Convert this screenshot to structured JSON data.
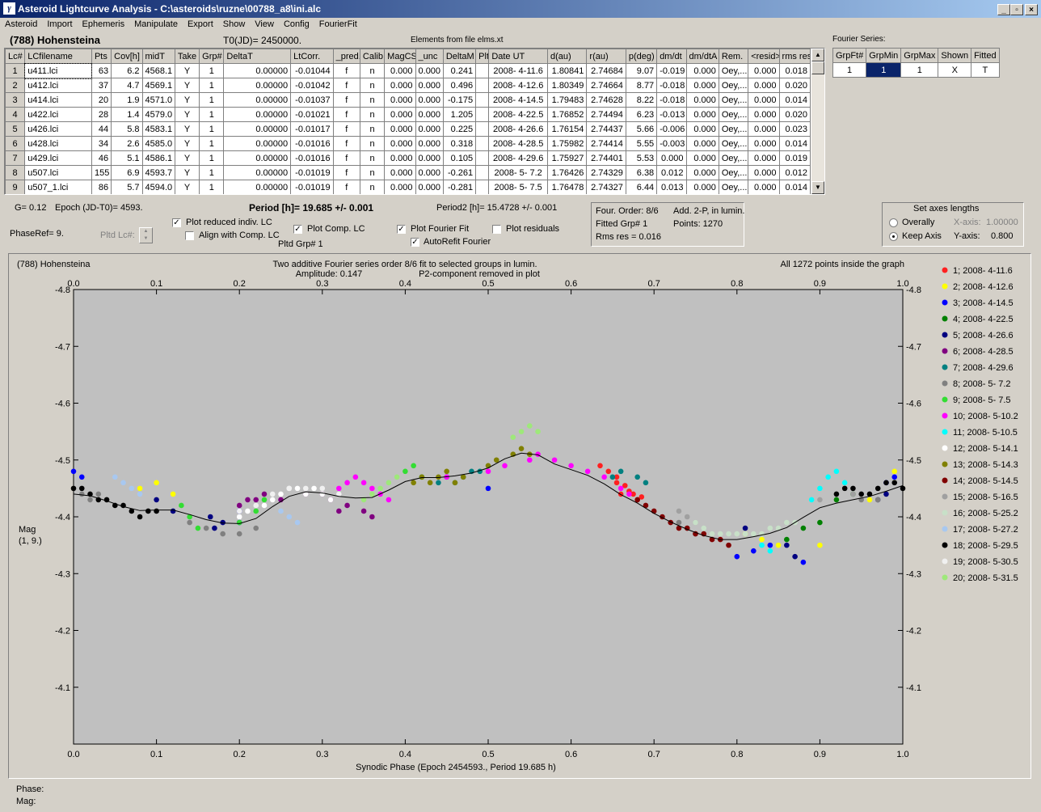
{
  "window": {
    "title": "Asteroid Lightcurve Analysis - C:\\asteroids\\ruzne\\00788_a8\\ini.alc",
    "min_label": "_",
    "max_label": "▫",
    "close_label": "×"
  },
  "menu": [
    "Asteroid",
    "Import",
    "Ephemeris",
    "Manipulate",
    "Export",
    "Show",
    "View",
    "Config",
    "FourierFit"
  ],
  "header": {
    "asteroid": "(788) Hohensteina",
    "t0": "T0(JD)= 2450000.",
    "elements": "Elements from file elms.xt"
  },
  "lc_table": {
    "columns": [
      "Lc#",
      "LCfilename",
      "Pts",
      "Cov[h]",
      "midT",
      "Take",
      "Grp#",
      "DeltaT",
      "LtCorr.",
      "_pred.",
      "Calib.",
      "MagCS",
      "_unc",
      "DeltaM",
      "Plt",
      "Date UT",
      "d(au)",
      "r(au)",
      "p(deg)",
      "dm/dt",
      "dm/dtA",
      "Rem.",
      "<resid>",
      "rms res"
    ],
    "rows": [
      [
        "1",
        "u411.lci",
        "63",
        "6.2",
        "4568.1",
        "Y",
        "1",
        "0.00000",
        "-0.01044",
        "f",
        "n",
        "0.000",
        "0.000",
        "0.241",
        "",
        "2008- 4-11.6",
        "1.80841",
        "2.74684",
        "9.07",
        "-0.019",
        "0.000",
        "Oey,...",
        "0.000",
        "0.018"
      ],
      [
        "2",
        "u412.lci",
        "37",
        "4.7",
        "4569.1",
        "Y",
        "1",
        "0.00000",
        "-0.01042",
        "f",
        "n",
        "0.000",
        "0.000",
        "0.496",
        "",
        "2008- 4-12.6",
        "1.80349",
        "2.74664",
        "8.77",
        "-0.018",
        "0.000",
        "Oey,...",
        "0.000",
        "0.020"
      ],
      [
        "3",
        "u414.lci",
        "20",
        "1.9",
        "4571.0",
        "Y",
        "1",
        "0.00000",
        "-0.01037",
        "f",
        "n",
        "0.000",
        "0.000",
        "-0.175",
        "",
        "2008- 4-14.5",
        "1.79483",
        "2.74628",
        "8.22",
        "-0.018",
        "0.000",
        "Oey,...",
        "0.000",
        "0.014"
      ],
      [
        "4",
        "u422.lci",
        "28",
        "1.4",
        "4579.0",
        "Y",
        "1",
        "0.00000",
        "-0.01021",
        "f",
        "n",
        "0.000",
        "0.000",
        "1.205",
        "",
        "2008- 4-22.5",
        "1.76852",
        "2.74494",
        "6.23",
        "-0.013",
        "0.000",
        "Oey,...",
        "0.000",
        "0.020"
      ],
      [
        "5",
        "u426.lci",
        "44",
        "5.8",
        "4583.1",
        "Y",
        "1",
        "0.00000",
        "-0.01017",
        "f",
        "n",
        "0.000",
        "0.000",
        "0.225",
        "",
        "2008- 4-26.6",
        "1.76154",
        "2.74437",
        "5.66",
        "-0.006",
        "0.000",
        "Oey,...",
        "0.000",
        "0.023"
      ],
      [
        "6",
        "u428.lci",
        "34",
        "2.6",
        "4585.0",
        "Y",
        "1",
        "0.00000",
        "-0.01016",
        "f",
        "n",
        "0.000",
        "0.000",
        "0.318",
        "",
        "2008- 4-28.5",
        "1.75982",
        "2.74414",
        "5.55",
        "-0.003",
        "0.000",
        "Oey,...",
        "0.000",
        "0.014"
      ],
      [
        "7",
        "u429.lci",
        "46",
        "5.1",
        "4586.1",
        "Y",
        "1",
        "0.00000",
        "-0.01016",
        "f",
        "n",
        "0.000",
        "0.000",
        "0.105",
        "",
        "2008- 4-29.6",
        "1.75927",
        "2.74401",
        "5.53",
        "0.000",
        "0.000",
        "Oey,...",
        "0.000",
        "0.019"
      ],
      [
        "8",
        "u507.lci",
        "155",
        "6.9",
        "4593.7",
        "Y",
        "1",
        "0.00000",
        "-0.01019",
        "f",
        "n",
        "0.000",
        "0.000",
        "-0.261",
        "",
        "2008- 5- 7.2",
        "1.76426",
        "2.74329",
        "6.38",
        "0.012",
        "0.000",
        "Oey,...",
        "0.000",
        "0.012"
      ],
      [
        "9",
        "u507_1.lci",
        "86",
        "5.7",
        "4594.0",
        "Y",
        "1",
        "0.00000",
        "-0.01019",
        "f",
        "n",
        "0.000",
        "0.000",
        "-0.281",
        "",
        "2008- 5- 7.5",
        "1.76478",
        "2.74327",
        "6.44",
        "0.013",
        "0.000",
        "Oey,...",
        "0.000",
        "0.014"
      ]
    ]
  },
  "fourier_series": {
    "label": "Fourier Series:",
    "columns": [
      "GrpFt#",
      "GrpMin",
      "GrpMax",
      "Shown",
      "Fitted"
    ],
    "row": [
      "1",
      "1",
      "1",
      "X",
      "T"
    ]
  },
  "params": {
    "g": "G= 0.12",
    "epoch": "Epoch (JD-T0)= 4593.",
    "phaseref": "PhaseRef= 9.",
    "period": "Period [h]= 19.685 +/- 0.001",
    "period2": "Period2 [h]= 15.4728 +/- 0.001",
    "pltd_lc": "Pltd Lc#:",
    "pltd_grp": "Pltd Grp#  1"
  },
  "checkboxes": [
    {
      "label": "Plot reduced indiv. LC",
      "checked": true
    },
    {
      "label": "Align with Comp. LC",
      "checked": false
    },
    {
      "label": "Plot Comp. LC",
      "checked": true
    },
    {
      "label": "Plot Fourier Fit",
      "checked": true
    },
    {
      "label": "AutoRefit Fourier",
      "checked": true
    },
    {
      "label": "Plot residuals",
      "checked": false
    }
  ],
  "fit_info": {
    "order": "Four. Order:  8/6",
    "add": "Add. 2-P, in lumin.",
    "fitted": "Fitted Grp# 1",
    "points": "Points: 1270",
    "rms": "Rms res     = 0.016"
  },
  "axes_box": {
    "title": "Set axes lengths",
    "overally": "Overally",
    "keep": "Keep Axis",
    "xaxis_label": "X-axis:",
    "xaxis_val": "1.00000",
    "yaxis_label": "Y-axis:",
    "yaxis_val": "0.800"
  },
  "status": {
    "phase": "Phase:",
    "mag": "Mag:"
  },
  "chart_data": {
    "type": "scatter",
    "title": "Two additive Fourier series order 8/6 fit to selected groups in lumin.",
    "subtitle_amp": "Amplitude: 0.147",
    "subtitle_p2": "P2-component removed in plot",
    "name_label": "(788) Hohensteina",
    "points_note": "All 1272 points inside the graph",
    "xlabel": "Synodic Phase (Epoch 2454593., Period 19.685 h)",
    "ylabel": "Mag",
    "ylabel2": "(1, 9.)",
    "xlim": [
      0,
      1
    ],
    "ylim": [
      -4.8,
      -4.0
    ],
    "xticks": [
      "0.0",
      "0.1",
      "0.2",
      "0.3",
      "0.4",
      "0.5",
      "0.6",
      "0.7",
      "0.8",
      "0.9",
      "1.0"
    ],
    "yticks": [
      "-4.8",
      "-4.7",
      "-4.6",
      "-4.5",
      "-4.4",
      "-4.3",
      "-4.2",
      "-4.1"
    ],
    "yticks_values": [
      -4.8,
      -4.7,
      -4.6,
      -4.5,
      -4.4,
      -4.3,
      -4.2,
      -4.1
    ],
    "grid": false,
    "fit_curve": {
      "x": [
        0.0,
        0.02,
        0.04,
        0.06,
        0.08,
        0.1,
        0.12,
        0.14,
        0.16,
        0.18,
        0.2,
        0.22,
        0.24,
        0.26,
        0.28,
        0.3,
        0.32,
        0.34,
        0.36,
        0.38,
        0.4,
        0.42,
        0.44,
        0.46,
        0.48,
        0.5,
        0.52,
        0.54,
        0.56,
        0.58,
        0.6,
        0.62,
        0.64,
        0.66,
        0.68,
        0.7,
        0.72,
        0.74,
        0.76,
        0.78,
        0.8,
        0.82,
        0.84,
        0.86,
        0.88,
        0.9,
        0.92,
        0.94,
        0.96,
        0.98,
        1.0
      ],
      "y": [
        -4.44,
        -4.437,
        -4.428,
        -4.418,
        -4.411,
        -4.412,
        -4.412,
        -4.404,
        -4.395,
        -4.389,
        -4.388,
        -4.397,
        -4.418,
        -4.436,
        -4.444,
        -4.442,
        -4.436,
        -4.433,
        -4.434,
        -4.447,
        -4.462,
        -4.469,
        -4.469,
        -4.472,
        -4.477,
        -4.486,
        -4.502,
        -4.512,
        -4.509,
        -4.493,
        -4.483,
        -4.473,
        -4.458,
        -4.439,
        -4.424,
        -4.406,
        -4.391,
        -4.378,
        -4.367,
        -4.36,
        -4.36,
        -4.365,
        -4.371,
        -4.381,
        -4.399,
        -4.416,
        -4.424,
        -4.43,
        -4.436,
        -4.445,
        -4.455
      ]
    },
    "series": [
      {
        "name": "1; 2008- 4-11.6",
        "color": "#ff2020",
        "x": [
          0.635,
          0.655,
          0.665,
          0.66,
          0.67,
          0.68,
          0.645,
          0.655,
          0.675,
          0.685
        ],
        "y": [
          -4.49,
          -4.47,
          -4.455,
          -4.44,
          -4.445,
          -4.43,
          -4.48,
          -4.46,
          -4.44,
          -4.435
        ]
      },
      {
        "name": "2; 2008- 4-12.6",
        "color": "#ffff00",
        "x": [
          0.1,
          0.12,
          0.81,
          0.83,
          0.85,
          0.9,
          0.99,
          0.08,
          0.96
        ],
        "y": [
          -4.46,
          -4.44,
          -4.37,
          -4.36,
          -4.35,
          -4.35,
          -4.48,
          -4.45,
          -4.43
        ]
      },
      {
        "name": "3; 2008- 4-14.5",
        "color": "#0000ff",
        "x": [
          0.0,
          0.01,
          0.2,
          0.2,
          0.5,
          0.8,
          0.82,
          0.84,
          0.88,
          0.99,
          0.98
        ],
        "y": [
          -4.48,
          -4.47,
          -4.41,
          -4.39,
          -4.45,
          -4.33,
          -4.34,
          -4.35,
          -4.32,
          -4.47,
          -4.46
        ]
      },
      {
        "name": "4; 2008- 4-22.5",
        "color": "#008000",
        "x": [
          0.86,
          0.88,
          0.9,
          0.92,
          0.94
        ],
        "y": [
          -4.36,
          -4.38,
          -4.39,
          -4.43,
          -4.44
        ]
      },
      {
        "name": "5; 2008- 4-26.6",
        "color": "#000080",
        "x": [
          0.1,
          0.12,
          0.165,
          0.17,
          0.18,
          0.81,
          0.86,
          0.87,
          0.97,
          0.98
        ],
        "y": [
          -4.43,
          -4.41,
          -4.4,
          -4.38,
          -4.39,
          -4.38,
          -4.35,
          -4.33,
          -4.43,
          -4.44
        ]
      },
      {
        "name": "6; 2008- 4-28.5",
        "color": "#800080",
        "x": [
          0.2,
          0.21,
          0.22,
          0.23,
          0.25,
          0.28,
          0.3,
          0.31,
          0.33,
          0.32,
          0.35,
          0.36
        ],
        "y": [
          -4.42,
          -4.43,
          -4.43,
          -4.44,
          -4.43,
          -4.44,
          -4.44,
          -4.43,
          -4.42,
          -4.41,
          -4.41,
          -4.4
        ]
      },
      {
        "name": "7; 2008- 4-29.6",
        "color": "#008080",
        "x": [
          0.42,
          0.44,
          0.45,
          0.46,
          0.47,
          0.48,
          0.49,
          0.65,
          0.66,
          0.68,
          0.69
        ],
        "y": [
          -4.47,
          -4.46,
          -4.47,
          -4.46,
          -4.47,
          -4.48,
          -4.48,
          -4.47,
          -4.48,
          -4.47,
          -4.46
        ]
      },
      {
        "name": "8; 2008- 5- 7.2",
        "color": "#808080",
        "x": [
          0.01,
          0.02,
          0.03,
          0.04,
          0.14,
          0.16,
          0.18,
          0.2,
          0.22,
          0.73,
          0.74,
          0.75,
          0.95,
          0.96,
          0.97
        ],
        "y": [
          -4.44,
          -4.43,
          -4.44,
          -4.43,
          -4.39,
          -4.38,
          -4.37,
          -4.37,
          -4.38,
          -4.39,
          -4.38,
          -4.37,
          -4.43,
          -4.44,
          -4.43
        ]
      },
      {
        "name": "9; 2008- 5- 7.5",
        "color": "#33dd33",
        "x": [
          0.13,
          0.14,
          0.15,
          0.2,
          0.22,
          0.23,
          0.4,
          0.41,
          0.42
        ],
        "y": [
          -4.42,
          -4.4,
          -4.38,
          -4.39,
          -4.41,
          -4.43,
          -4.48,
          -4.49,
          -4.47
        ]
      },
      {
        "name": "10; 2008- 5-10.2",
        "color": "#ff00ff",
        "x": [
          0.32,
          0.33,
          0.34,
          0.35,
          0.36,
          0.37,
          0.38,
          0.45,
          0.5,
          0.52,
          0.55,
          0.56,
          0.58,
          0.6,
          0.62,
          0.64,
          0.66,
          0.67
        ],
        "y": [
          -4.45,
          -4.46,
          -4.47,
          -4.46,
          -4.45,
          -4.44,
          -4.43,
          -4.47,
          -4.48,
          -4.49,
          -4.5,
          -4.51,
          -4.5,
          -4.49,
          -4.48,
          -4.47,
          -4.45,
          -4.44
        ]
      },
      {
        "name": "11; 2008- 5-10.5",
        "color": "#00ffff",
        "x": [
          0.83,
          0.84,
          0.89,
          0.9,
          0.91,
          0.92,
          0.93
        ],
        "y": [
          -4.35,
          -4.34,
          -4.43,
          -4.45,
          -4.47,
          -4.48,
          -4.46
        ]
      },
      {
        "name": "12; 2008- 5-14.1",
        "color": "#ffffff",
        "x": [
          0.2,
          0.21,
          0.23,
          0.24,
          0.25,
          0.26,
          0.27,
          0.28,
          0.29,
          0.3,
          0.31
        ],
        "y": [
          -4.4,
          -4.41,
          -4.42,
          -4.43,
          -4.44,
          -4.45,
          -4.45,
          -4.44,
          -4.45,
          -4.44,
          -4.43
        ]
      },
      {
        "name": "13; 2008- 5-14.3",
        "color": "#808000",
        "x": [
          0.41,
          0.42,
          0.43,
          0.44,
          0.45,
          0.46,
          0.47,
          0.5,
          0.51,
          0.53,
          0.54,
          0.55
        ],
        "y": [
          -4.46,
          -4.47,
          -4.46,
          -4.47,
          -4.48,
          -4.46,
          -4.47,
          -4.49,
          -4.5,
          -4.51,
          -4.52,
          -4.51
        ]
      },
      {
        "name": "14; 2008- 5-14.5",
        "color": "#800000",
        "x": [
          0.68,
          0.69,
          0.7,
          0.71,
          0.72,
          0.73,
          0.74,
          0.75,
          0.76,
          0.77,
          0.78,
          0.79
        ],
        "y": [
          -4.43,
          -4.42,
          -4.41,
          -4.4,
          -4.39,
          -4.38,
          -4.38,
          -4.37,
          -4.37,
          -4.36,
          -4.36,
          -4.35
        ]
      },
      {
        "name": "15; 2008- 5-16.5",
        "color": "#a0a0a0",
        "x": [
          0.73,
          0.74,
          0.75,
          0.9,
          0.92,
          0.94
        ],
        "y": [
          -4.41,
          -4.4,
          -4.39,
          -4.43,
          -4.44,
          -4.44
        ]
      },
      {
        "name": "16; 2008- 5-25.2",
        "color": "#c8e0c8",
        "x": [
          0.75,
          0.76,
          0.77,
          0.78,
          0.79,
          0.8,
          0.81,
          0.82,
          0.83,
          0.84,
          0.85,
          0.86,
          0.87
        ],
        "y": [
          -4.39,
          -4.38,
          -4.37,
          -4.37,
          -4.37,
          -4.37,
          -4.37,
          -4.37,
          -4.37,
          -4.38,
          -4.38,
          -4.39,
          -4.39
        ]
      },
      {
        "name": "17; 2008- 5-27.2",
        "color": "#a8c8f0",
        "x": [
          0.05,
          0.06,
          0.07,
          0.08,
          0.25,
          0.26,
          0.27
        ],
        "y": [
          -4.47,
          -4.46,
          -4.45,
          -4.44,
          -4.41,
          -4.4,
          -4.39
        ]
      },
      {
        "name": "18; 2008- 5-29.5",
        "color": "#000000",
        "x": [
          0.0,
          0.01,
          0.02,
          0.03,
          0.04,
          0.05,
          0.06,
          0.07,
          0.08,
          0.09,
          0.1,
          0.92,
          0.93,
          0.94,
          0.95,
          0.96,
          0.97,
          0.98,
          0.99,
          1.0
        ],
        "y": [
          -4.45,
          -4.45,
          -4.44,
          -4.43,
          -4.43,
          -4.42,
          -4.42,
          -4.41,
          -4.4,
          -4.41,
          -4.41,
          -4.44,
          -4.45,
          -4.45,
          -4.44,
          -4.44,
          -4.45,
          -4.46,
          -4.46,
          -4.45
        ]
      },
      {
        "name": "19; 2008- 5-30.5",
        "color": "#f0f0f0",
        "x": [
          0.2,
          0.22,
          0.24,
          0.26,
          0.28,
          0.3,
          0.32
        ],
        "y": [
          -4.41,
          -4.42,
          -4.44,
          -4.45,
          -4.45,
          -4.45,
          -4.44
        ]
      },
      {
        "name": "20; 2008- 5-31.5",
        "color": "#9ee87a",
        "x": [
          0.35,
          0.36,
          0.37,
          0.38,
          0.39,
          0.53,
          0.54,
          0.55,
          0.56
        ],
        "y": [
          -4.43,
          -4.44,
          -4.45,
          -4.46,
          -4.47,
          -4.54,
          -4.55,
          -4.56,
          -4.55
        ]
      }
    ]
  }
}
